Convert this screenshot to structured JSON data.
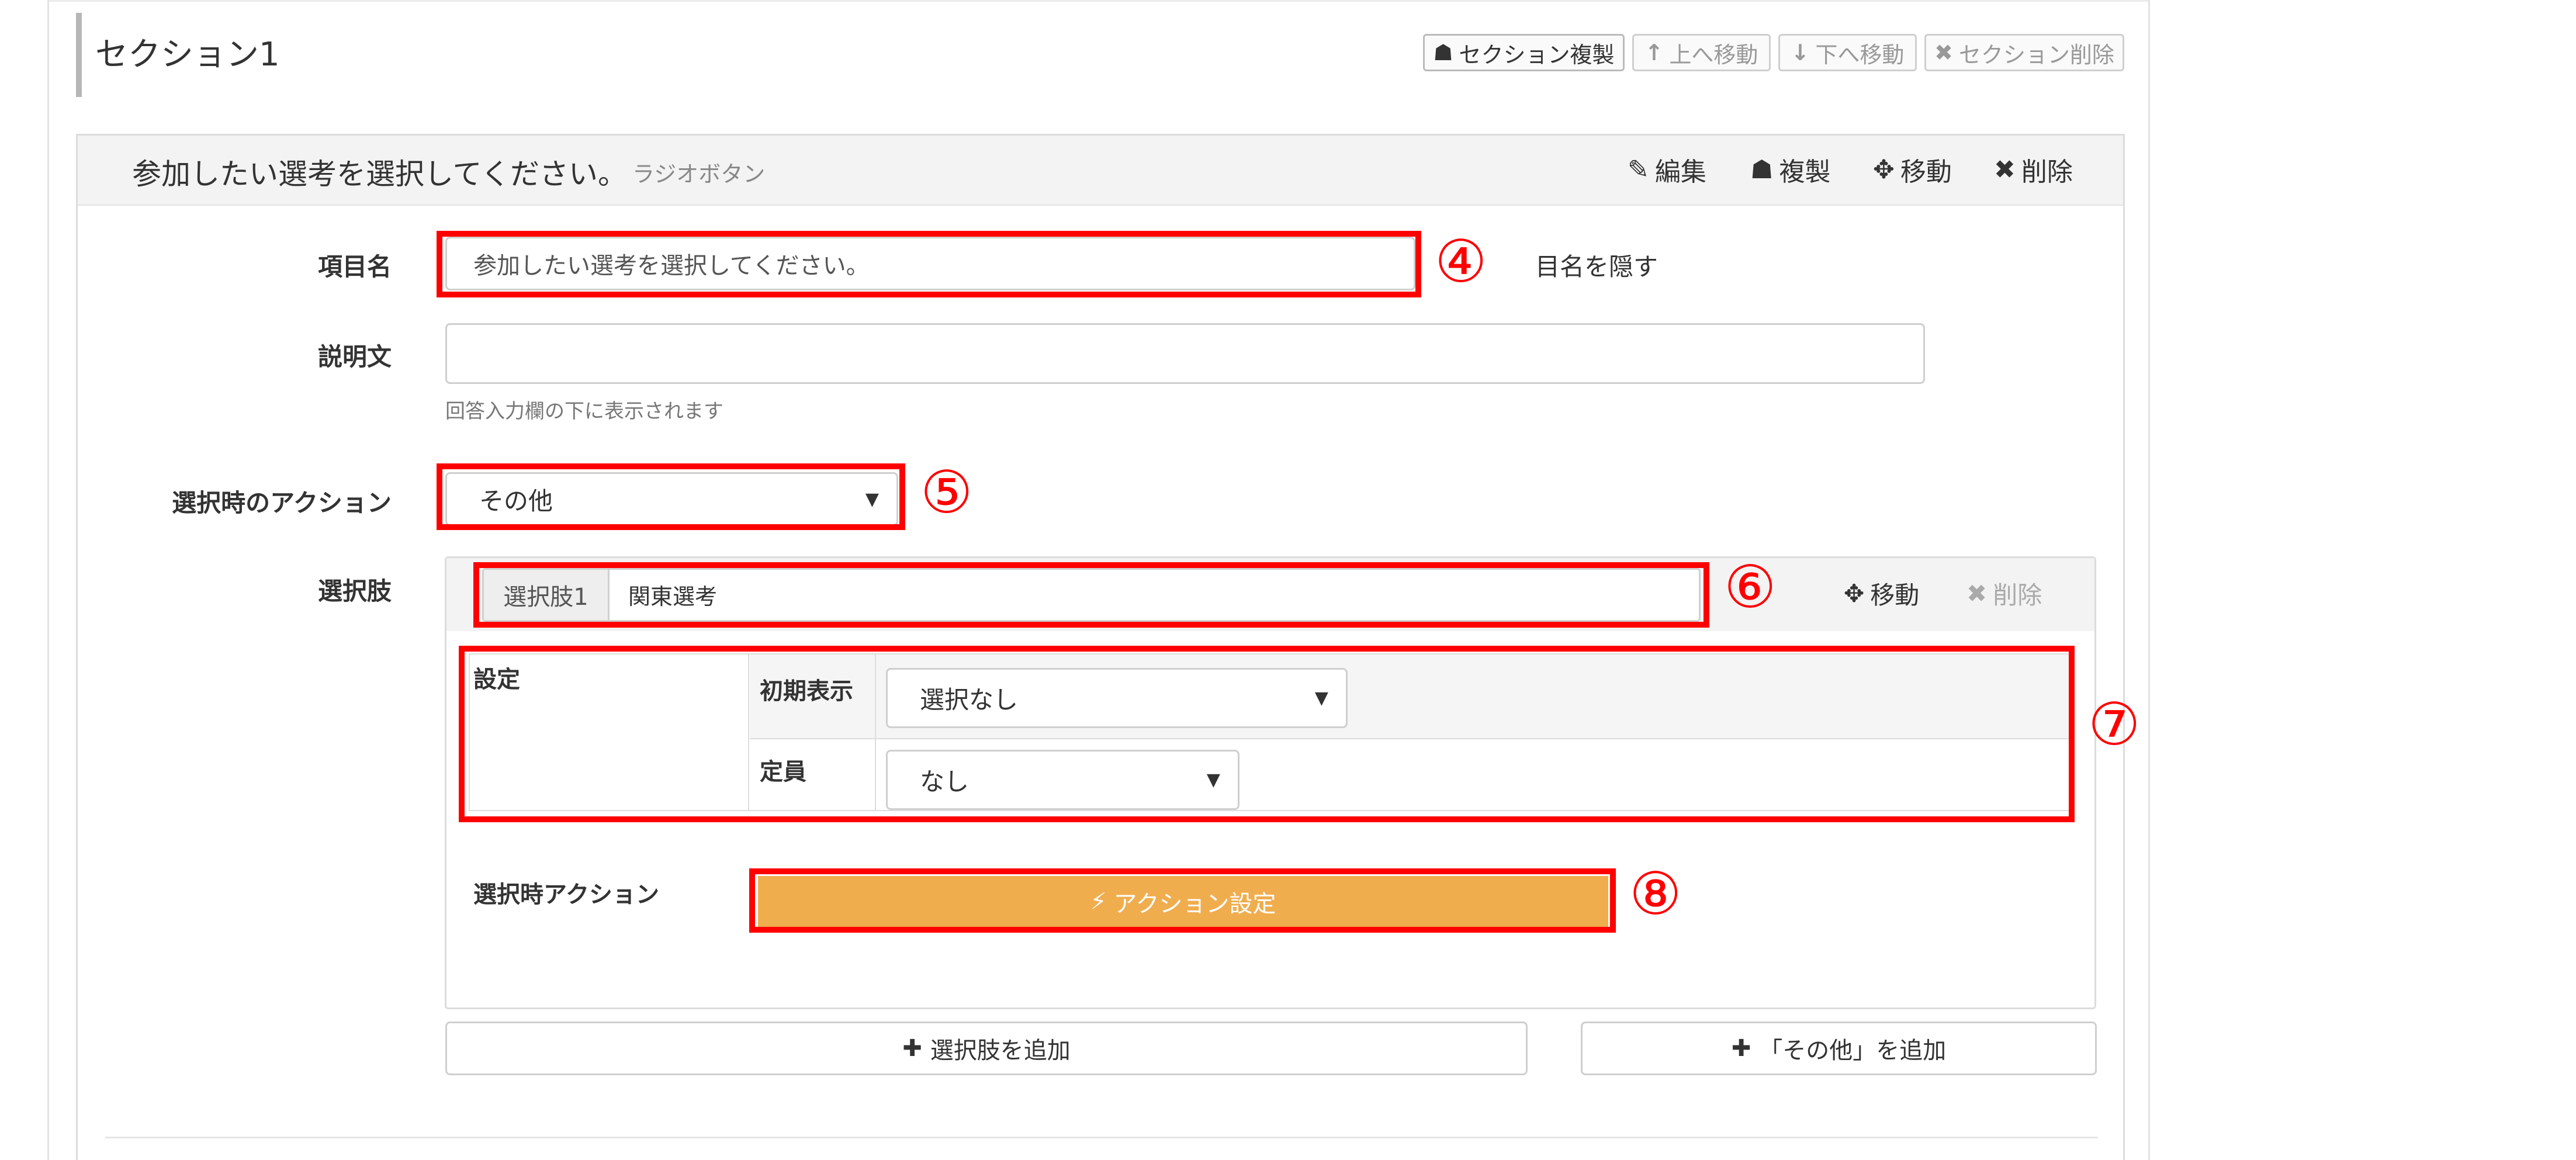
{
  "section": {
    "title": "セクション1",
    "buttons": {
      "duplicate": {
        "icon": "☗",
        "label": "セクション複製"
      },
      "move_up": {
        "icon": "↑",
        "label": "上へ移動"
      },
      "move_down": {
        "icon": "↓",
        "label": "下へ移動"
      },
      "delete": {
        "icon": "✖",
        "label": "セクション削除"
      }
    }
  },
  "item": {
    "title": "参加したい選考を選択してください。",
    "type": "ラジオボタン",
    "actions": {
      "edit": {
        "icon": "✎",
        "label": "編集"
      },
      "duplicate": {
        "icon": "☗",
        "label": "複製"
      },
      "move": {
        "icon": "✥",
        "label": "移動"
      },
      "delete": {
        "icon": "✖",
        "label": "削除"
      }
    }
  },
  "form": {
    "name_label": "項目名",
    "name_value": "参加したい選考を選択してください。",
    "hide_name_label": "目名を隠す",
    "description_label": "説明文",
    "description_value": "",
    "description_help": "回答入力欄の下に表示されます",
    "action_label": "選択時のアクション",
    "action_value": "その他",
    "choices_label": "選択肢"
  },
  "choice": {
    "addon": "選択肢1",
    "value": "関東選考",
    "move": {
      "icon": "✥",
      "label": "移動"
    },
    "delete": {
      "icon": "✖",
      "label": "削除"
    },
    "settings_label": "設定",
    "initial_display_label": "初期表示",
    "initial_display_value": "選択なし",
    "capacity_label": "定員",
    "capacity_value": "なし",
    "select_action_label": "選択時アクション",
    "action_button": {
      "icon": "⚡",
      "label": "アクション設定"
    }
  },
  "footer_buttons": {
    "add_choice": {
      "icon": "✚",
      "label": "選択肢を追加"
    },
    "add_other": {
      "icon": "✚",
      "label": "「その他」を追加"
    }
  },
  "annotations": {
    "n4": "④",
    "n5": "⑤",
    "n6": "⑥",
    "n7": "⑦",
    "n8": "⑧"
  },
  "colors": {
    "annotation_red": "#ff0000",
    "action_button": "#f0ad4e",
    "header_bg": "#f3f3f3"
  }
}
